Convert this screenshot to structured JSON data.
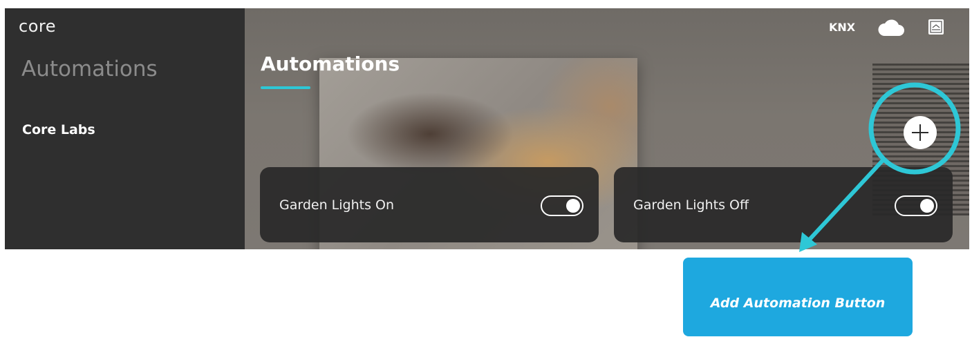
{
  "sidebar": {
    "logo": "core",
    "title": "Automations",
    "items": [
      {
        "label": "Core Labs"
      }
    ]
  },
  "header": {
    "title": "Automations",
    "status": {
      "protocol": "KNX",
      "cloud_icon": "cloud-icon",
      "gateway_icon": "gateway-icon"
    }
  },
  "actions": {
    "add_icon": "plus-icon"
  },
  "automations": [
    {
      "name": "Garden Lights On",
      "enabled": true
    },
    {
      "name": "Garden Lights Off",
      "enabled": true
    }
  ],
  "annotation": {
    "label": "Add Automation Button",
    "highlight_color": "#2ec7d6",
    "callout_color": "#1ea8df"
  },
  "colors": {
    "accent": "#2ec7d6",
    "sidebar_bg": "#2f2f2f",
    "card_bg": "#282828"
  }
}
